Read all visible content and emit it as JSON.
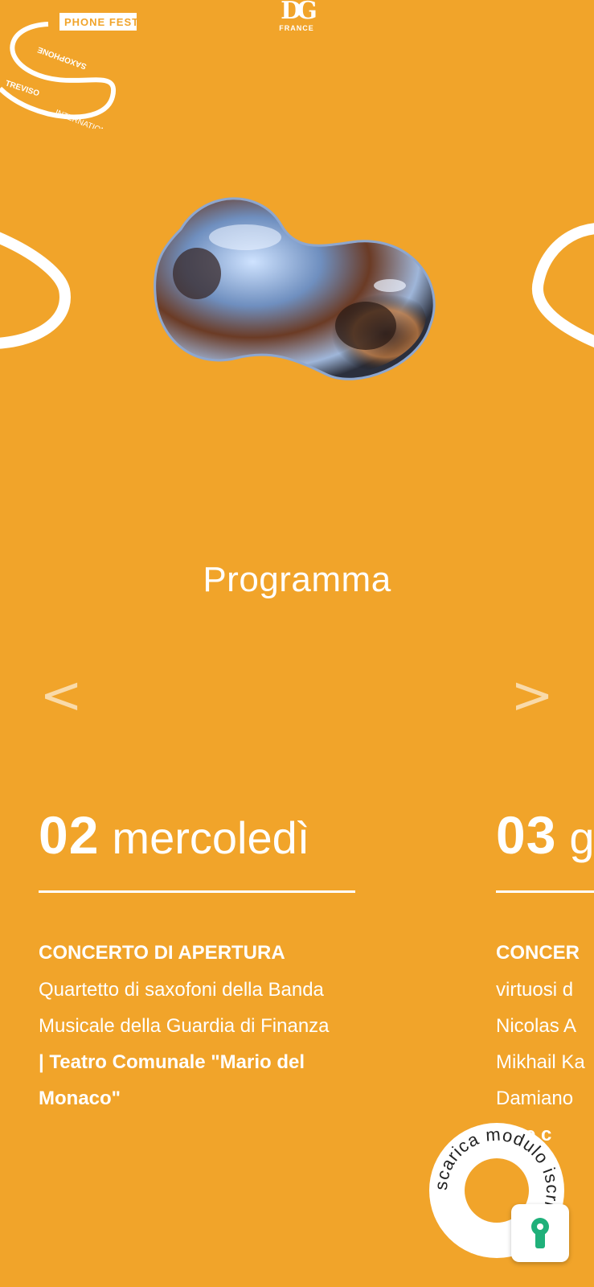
{
  "header": {
    "festival_logo": {
      "top_text": "PHONE FESTIVAL",
      "ring_text_1": "TREVISO INTERNATIONAL SAXOPHONE",
      "icon": "festival-s-logo"
    },
    "brand_logo": {
      "mark": "DG",
      "sub": "FRANCE"
    }
  },
  "programme": {
    "title": "Programma",
    "prev_label": "<",
    "next_label": ">",
    "days": [
      {
        "number": "02",
        "weekday": "mercoledì",
        "event_title": "CONCERTO DI APERTURA",
        "description": "Quartetto di saxofoni della Banda Musicale della Guardia di Finanza",
        "venue": "| Teatro Comunale \"Mario del Monaco\""
      },
      {
        "number": "03",
        "weekday": "g",
        "event_title": "CONCER",
        "description": "virtuosi d Nicolas A Mikhail Ka Damiano",
        "venue": "lone c"
      }
    ]
  },
  "download_badge": {
    "text": "scarica modulo iscrizione"
  },
  "colors": {
    "background": "#F1A42A",
    "text": "#ffffff",
    "lock_icon": "#1FB07A"
  }
}
